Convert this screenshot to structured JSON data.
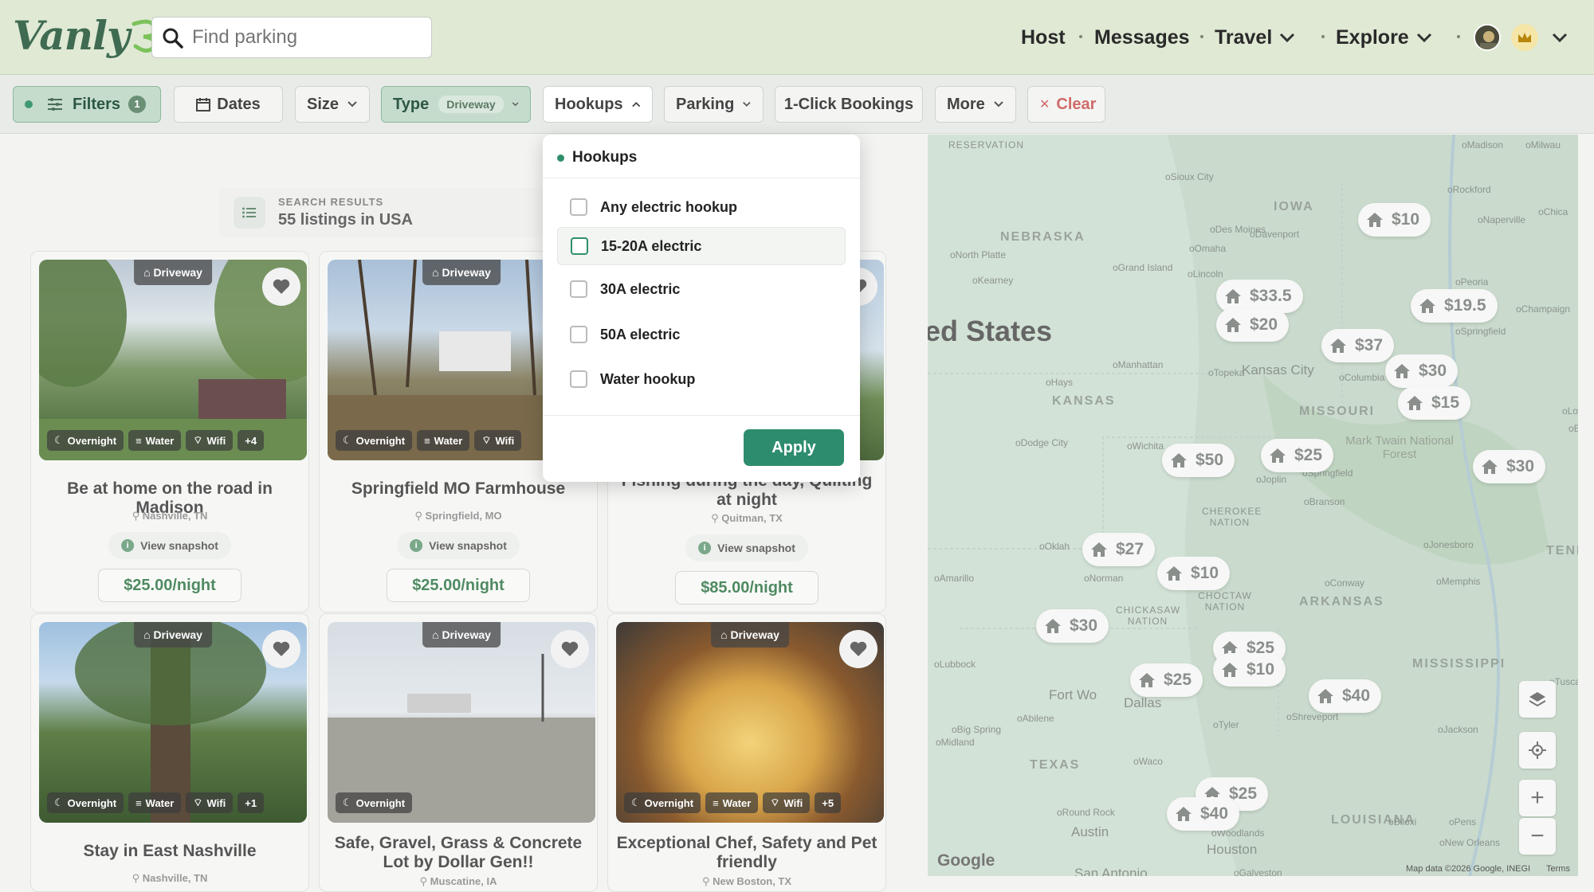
{
  "header": {
    "logo_text": "Vanly",
    "search_placeholder": "Find parking",
    "nav": [
      "Host",
      "Messages",
      "Travel",
      "Explore"
    ]
  },
  "filters": {
    "filters_label": "Filters",
    "filters_count": "1",
    "dates": "Dates",
    "size": "Size",
    "type": "Type",
    "type_value": "Driveway",
    "hookups": "Hookups",
    "parking": "Parking",
    "one_click": "1-Click Bookings",
    "more": "More",
    "clear": "Clear"
  },
  "results": {
    "small": "SEARCH RESULTS",
    "big": "55 listings in USA"
  },
  "hookups_dropdown": {
    "title": "Hookups",
    "options": [
      "Any electric hookup",
      "15-20A electric",
      "30A electric",
      "50A electric",
      "Water hookup"
    ],
    "apply": "Apply"
  },
  "listings": [
    {
      "tag": "Driveway",
      "amenities": [
        "Overnight",
        "Water",
        "Wifi",
        "+4"
      ],
      "title": "Be at home on the road in Madison",
      "location": "Nashville, TN",
      "snapshot": "View snapshot",
      "price": "$25.00/night"
    },
    {
      "tag": "Driveway",
      "amenities": [
        "Overnight",
        "Water",
        "Wifi"
      ],
      "title": "Springfield MO Farmhouse",
      "location": "Springfield, MO",
      "snapshot": "View snapshot",
      "price": "$25.00/night"
    },
    {
      "tag": "",
      "amenities": [],
      "title": "Fishing during the day, Quilting at night",
      "location": "Quitman, TX",
      "snapshot": "View snapshot",
      "price": "$85.00/night"
    },
    {
      "tag": "Driveway",
      "amenities": [
        "Overnight",
        "Water",
        "Wifi",
        "+1"
      ],
      "title": "Stay in East Nashville",
      "location": "Nashville, TN"
    },
    {
      "tag": "Driveway",
      "amenities": [
        "Overnight"
      ],
      "title": "Safe, Gravel, Grass & Concrete Lot by Dollar Gen!!",
      "location": "Muscatine, IA"
    },
    {
      "tag": "Driveway",
      "amenities": [
        "Overnight",
        "Water",
        "Wifi",
        "+5"
      ],
      "title": "Exceptional Chef, Safety and Pet friendly",
      "location": "New Boston, TX"
    }
  ],
  "map": {
    "country_label": "ed States",
    "states": [
      "NEBRASKA",
      "IOWA",
      "KANSAS",
      "MISSOURI",
      "ARKANSAS",
      "TEXAS",
      "LOUISIANA",
      "MISSISSIPPI",
      "TENN",
      "CHEROKEE NATION",
      "CHOCTAW NATION",
      "CHICKASAW NATION",
      "RESERVATION",
      "Mark Twain National Forest"
    ],
    "cities": [
      "Sioux City",
      "Omaha",
      "Lincoln",
      "Grand Island",
      "North Platte",
      "Kearney",
      "Des Moines",
      "Davenport",
      "Rockford",
      "Naperville",
      "Chica",
      "Madison",
      "Milwau",
      "Peoria",
      "Champaign",
      "Springfield",
      "Topeka",
      "Kansas City",
      "Columbia",
      "Manhattan",
      "Hays",
      "Dodge City",
      "Wichita",
      "Joplin",
      "Springfield",
      "Branson",
      "Lou",
      "Evansv",
      "Jonesboro",
      "Memphis",
      "Conway",
      "Amarillo",
      "Norman",
      "Lubbock",
      "Abilene",
      "Fort Wo",
      "Dallas",
      "Tyler",
      "Shreveport",
      "Jackson",
      "Big Spring",
      "Midland",
      "Waco",
      "Round Rock",
      "Austin",
      "San Antonio",
      "Houston",
      "Woodlands",
      "Galveston",
      "Biloxi",
      "Pens",
      "New Orleans",
      "Tuscal",
      "Oklah"
    ],
    "markers": [
      "$10",
      "$33.5",
      "$20",
      "$19.5",
      "$37",
      "$30",
      "$15",
      "$50",
      "$25",
      "$30",
      "$27",
      "$10",
      "$30",
      "$25",
      "$10",
      "$25",
      "$40",
      "$25",
      "$40"
    ],
    "google": "Google",
    "attribution": "Map data ©2026 Google, INEGI",
    "terms": "Terms"
  }
}
